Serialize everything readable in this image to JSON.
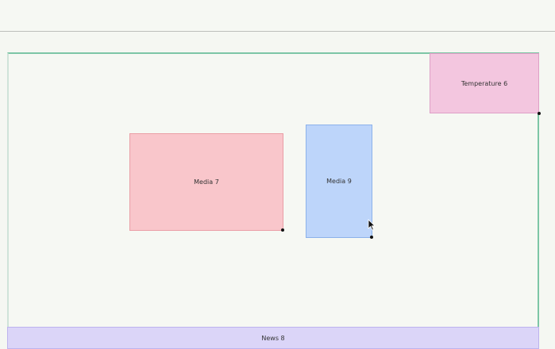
{
  "widgets": {
    "temperature": {
      "label": "Temperature 6",
      "color": "#f3c6df"
    },
    "media7": {
      "label": "Media 7",
      "color": "#f9c6cb"
    },
    "media9": {
      "label": "Media 9",
      "color": "#bdd5fa"
    },
    "news": {
      "label": "News 8",
      "color": "#dbd5f8"
    }
  },
  "colors": {
    "canvas_border": "#7dc6a6",
    "background": "#f5f7f2"
  },
  "icons": {
    "cursor": "mouse-pointer-icon"
  }
}
